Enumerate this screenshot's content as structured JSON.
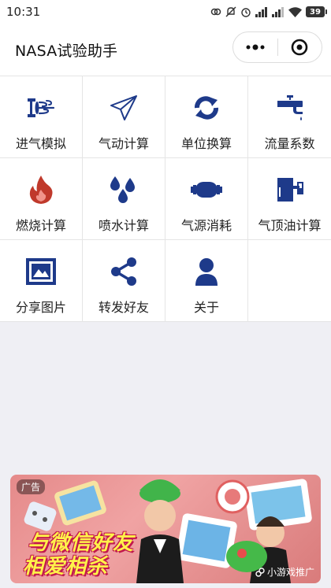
{
  "status_bar": {
    "time": "10:31",
    "battery": "39"
  },
  "nav": {
    "title": "NASA试验助手"
  },
  "grid": {
    "items": [
      {
        "label": "进气模拟",
        "icon": "intake-fan-icon"
      },
      {
        "label": "气动计算",
        "icon": "paper-plane-icon"
      },
      {
        "label": "单位换算",
        "icon": "sync-arrows-icon"
      },
      {
        "label": "流量系数",
        "icon": "faucet-icon"
      },
      {
        "label": "燃烧计算",
        "icon": "flame-icon"
      },
      {
        "label": "喷水计算",
        "icon": "water-drops-icon"
      },
      {
        "label": "气源消耗",
        "icon": "gas-cylinder-icon"
      },
      {
        "label": "气顶油计算",
        "icon": "oil-tank-icon"
      },
      {
        "label": "分享图片",
        "icon": "picture-icon"
      },
      {
        "label": "转发好友",
        "icon": "share-icon"
      },
      {
        "label": "关于",
        "icon": "user-icon"
      }
    ]
  },
  "ad": {
    "tag": "广告",
    "slogan_line1": "与微信好友",
    "slogan_line2": "相爱相杀",
    "source": "小游戏推广"
  },
  "colors": {
    "icon_blue": "#1e3a8a",
    "flame_red": "#c0392b",
    "page_bg": "#efeff4"
  }
}
